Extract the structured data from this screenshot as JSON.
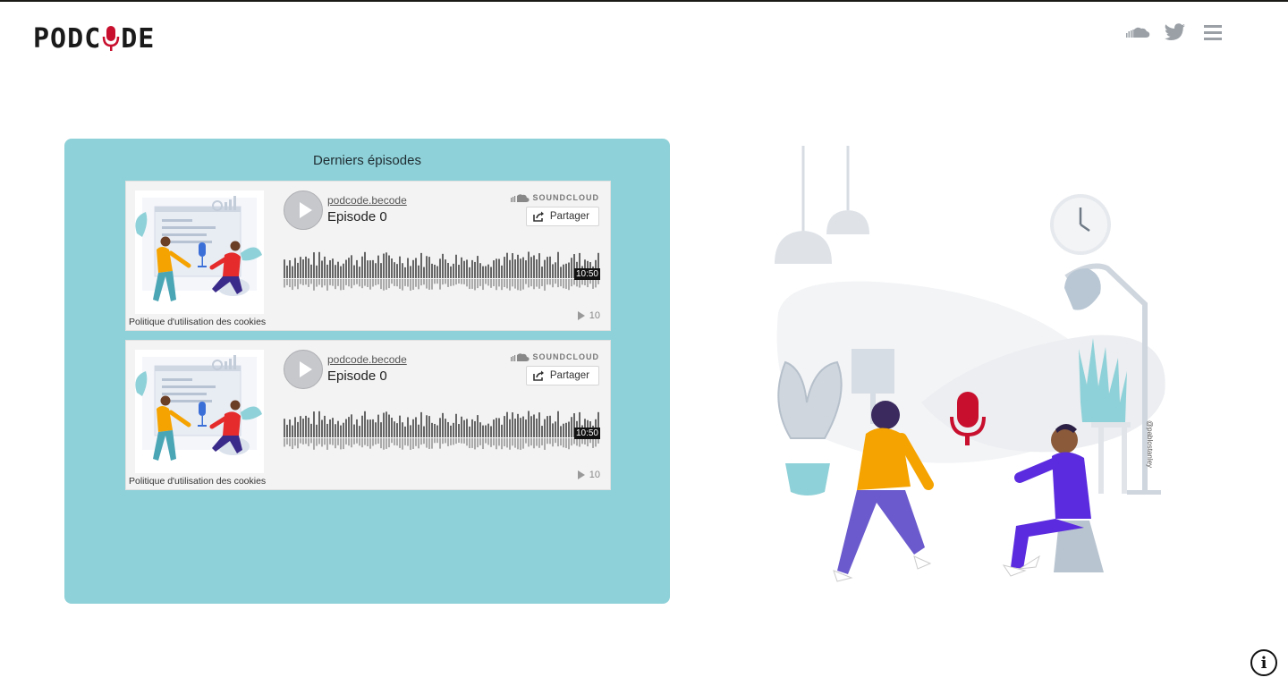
{
  "header": {
    "logo_left": "POD",
    "logo_mid": "C",
    "logo_right": "DE",
    "icons": [
      "soundcloud-icon",
      "twitter-icon",
      "menu-icon"
    ]
  },
  "episodes_panel": {
    "title": "Derniers épisodes",
    "cards": [
      {
        "user": "podcode.becode",
        "title": "Episode 0",
        "brand": "SOUNDCLOUD",
        "share_label": "Partager",
        "duration": "10:50",
        "plays": "10",
        "cookie_text": "Politique d'utilisation des cookies"
      },
      {
        "user": "podcode.becode",
        "title": "Episode 0",
        "brand": "SOUNDCLOUD",
        "share_label": "Partager",
        "duration": "10:50",
        "plays": "10",
        "cookie_text": "Politique d'utilisation des cookies"
      }
    ]
  },
  "illustration": {
    "credit": "@pablostanley"
  },
  "info_button": {
    "label": "i"
  },
  "colors": {
    "panel": "#8fd1d8",
    "accent_red": "#c8102e",
    "waveform": "#666666",
    "card": "#f3f3f3"
  }
}
